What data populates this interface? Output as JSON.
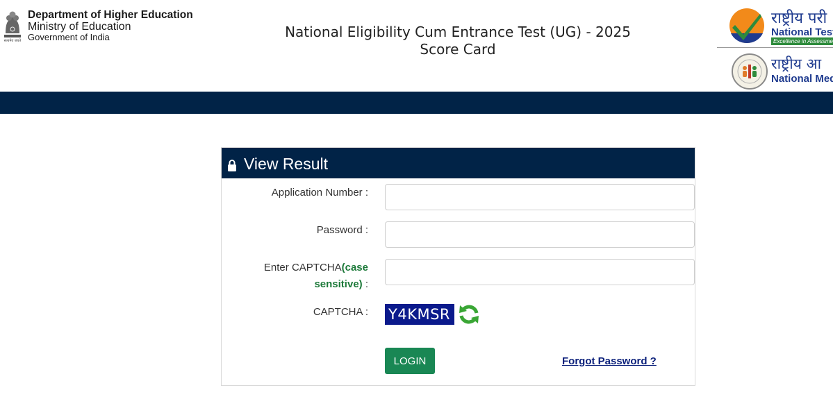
{
  "header": {
    "dept_line1": "Department of Higher Education",
    "dept_line2": "Ministry of Education",
    "dept_line3": "Government of India",
    "title_line1": "National Eligibility Cum Entrance Test (UG) - 2025",
    "title_line2": "Score Card",
    "nta_hindi": "राष्ट्रीय परी",
    "nta_english": "National Test",
    "nta_tagline": "Excellence in Assessment",
    "nmc_hindi": "राष्ट्रीय आ",
    "nmc_english": "National Med",
    "emblem_motto": "सत्यमेव जयते"
  },
  "colors": {
    "navbar": "#012347",
    "panel_header": "#012347",
    "login_button": "#198754",
    "captcha_bg": "#0b1a8c",
    "highlight_green": "#1d7a3a",
    "link": "#0a1f7a"
  },
  "panel": {
    "title": "View Result",
    "title_icon": "lock-icon",
    "application_label": "Application Number :",
    "application_value": "",
    "password_label": "Password :",
    "password_value": "",
    "captcha_entry_label_prefix": "Enter CAPTCHA",
    "captcha_entry_label_hint1": "(case",
    "captcha_entry_label_hint2": "sensitive)",
    "captcha_entry_label_suffix": " :",
    "captcha_entry_value": "",
    "captcha_label": "CAPTCHA :",
    "captcha_text": "Y4KMSR",
    "refresh_icon": "refresh-icon",
    "login_label": "LOGIN",
    "forgot_label": "Forgot Password ?"
  }
}
